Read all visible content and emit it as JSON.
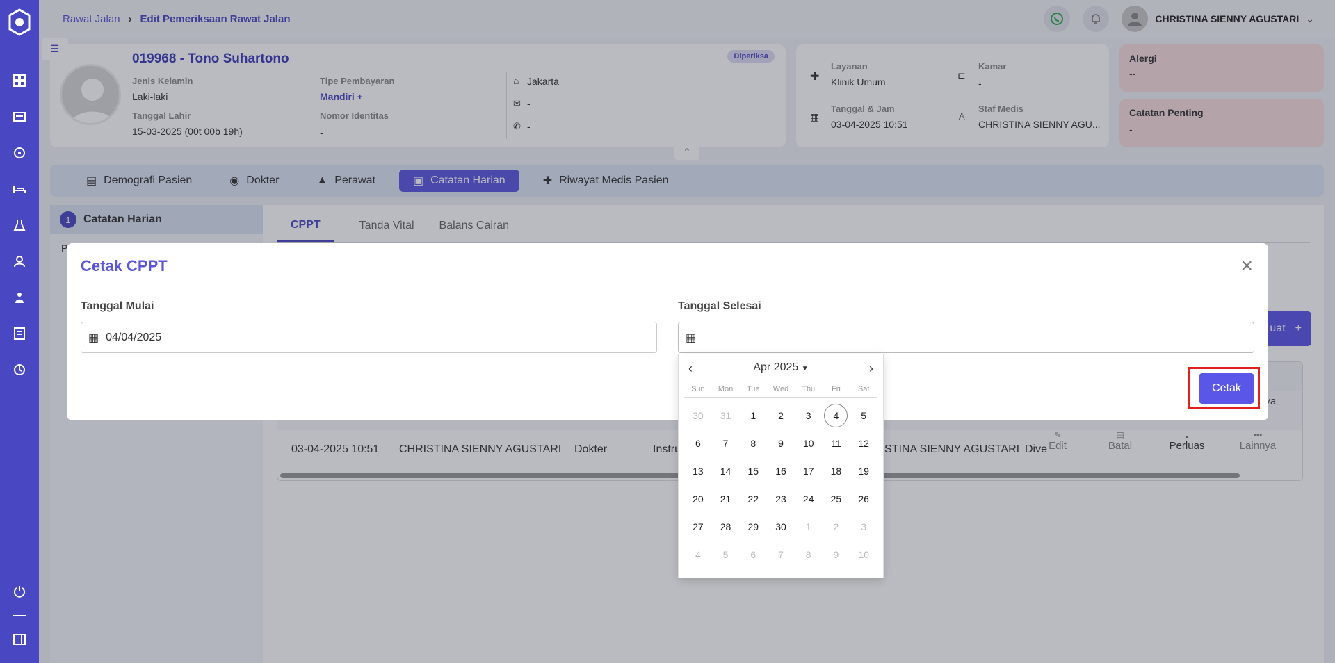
{
  "breadcrumb": {
    "parent": "Rawat Jalan",
    "current": "Edit Pemeriksaan Rawat Jalan"
  },
  "user": {
    "name": "CHRISTINA SIENNY AGUSTARI"
  },
  "patient": {
    "title": "019968 - Tono Suhartono",
    "status": "Diperiksa",
    "gender_label": "Jenis Kelamin",
    "gender": "Laki-laki",
    "dob_label": "Tanggal Lahir",
    "dob": "15-03-2025 (00t 00b 19h)",
    "payment_label": "Tipe Pembayaran",
    "payment": "Mandiri +",
    "id_label": "Nomor Identitas",
    "id_value": "-",
    "city": "Jakarta",
    "email": "-",
    "phone": "-"
  },
  "service": {
    "layanan_label": "Layanan",
    "layanan": "Klinik Umum",
    "kamar_label": "Kamar",
    "kamar": "-",
    "datetime_label": "Tanggal & Jam",
    "datetime": "03-04-2025 10:51",
    "staff_label": "Staf Medis",
    "staff": "CHRISTINA SIENNY AGU..."
  },
  "alerts": {
    "alergi_label": "Alergi",
    "alergi": "--",
    "catatan_label": "Catatan Penting",
    "catatan": "-"
  },
  "tabs": [
    {
      "label": "Demografi Pasien"
    },
    {
      "label": "Dokter"
    },
    {
      "label": "Perawat"
    },
    {
      "label": "Catatan Harian"
    },
    {
      "label": "Riwayat Medis Pasien"
    }
  ],
  "side": {
    "step": "1",
    "title": "Catatan Harian",
    "sub": "P"
  },
  "subtabs": [
    {
      "label": "CPPT"
    },
    {
      "label": "Tanda Vital"
    },
    {
      "label": "Balans Cairan"
    }
  ],
  "table": {
    "button_partial": "uat",
    "row": {
      "time": "03-04-2025 10:51",
      "name": "CHRISTINA SIENNY AGUSTARI",
      "role": "Dokter",
      "instr": "Instru",
      "name2": "STINA SIENNY AGUSTARI",
      "dive": "Dive"
    },
    "actions": {
      "edit": "Edit",
      "batal": "Batal",
      "perluas": "Perluas",
      "lainnya": "Lainnya"
    }
  },
  "modal": {
    "title": "Cetak CPPT",
    "start_label": "Tanggal Mulai",
    "start_value": "04/04/2025",
    "end_label": "Tanggal Selesai",
    "end_value": "",
    "print_button": "Cetak"
  },
  "calendar": {
    "month": "Apr 2025",
    "dow": [
      "Sun",
      "Mon",
      "Tue",
      "Wed",
      "Thu",
      "Fri",
      "Sat"
    ],
    "days": [
      {
        "d": "30",
        "m": true
      },
      {
        "d": "31",
        "m": true
      },
      {
        "d": "1"
      },
      {
        "d": "2"
      },
      {
        "d": "3"
      },
      {
        "d": "4",
        "today": true
      },
      {
        "d": "5"
      },
      {
        "d": "6"
      },
      {
        "d": "7"
      },
      {
        "d": "8"
      },
      {
        "d": "9"
      },
      {
        "d": "10"
      },
      {
        "d": "11"
      },
      {
        "d": "12"
      },
      {
        "d": "13"
      },
      {
        "d": "14"
      },
      {
        "d": "15"
      },
      {
        "d": "16"
      },
      {
        "d": "17"
      },
      {
        "d": "18"
      },
      {
        "d": "19"
      },
      {
        "d": "20"
      },
      {
        "d": "21"
      },
      {
        "d": "22"
      },
      {
        "d": "23"
      },
      {
        "d": "24"
      },
      {
        "d": "25"
      },
      {
        "d": "26"
      },
      {
        "d": "27"
      },
      {
        "d": "28"
      },
      {
        "d": "29"
      },
      {
        "d": "30"
      },
      {
        "d": "1",
        "m": true
      },
      {
        "d": "2",
        "m": true
      },
      {
        "d": "3",
        "m": true
      },
      {
        "d": "4",
        "m": true
      },
      {
        "d": "5",
        "m": true
      },
      {
        "d": "6",
        "m": true
      },
      {
        "d": "7",
        "m": true
      },
      {
        "d": "8",
        "m": true
      },
      {
        "d": "9",
        "m": true
      },
      {
        "d": "10",
        "m": true
      }
    ]
  }
}
